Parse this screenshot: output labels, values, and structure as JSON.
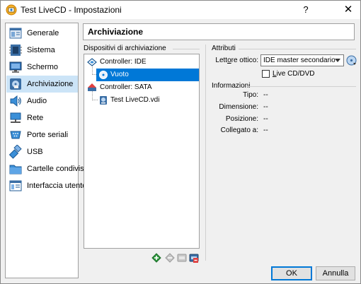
{
  "window": {
    "title": "Test LiveCD - Impostazioni",
    "help_label": "?",
    "close_label": "✕"
  },
  "nav": {
    "items": [
      {
        "label": "Generale",
        "icon": "general-icon"
      },
      {
        "label": "Sistema",
        "icon": "system-chip-icon"
      },
      {
        "label": "Schermo",
        "icon": "display-monitor-icon"
      },
      {
        "label": "Archiviazione",
        "icon": "storage-icon",
        "selected": true
      },
      {
        "label": "Audio",
        "icon": "speaker-icon"
      },
      {
        "label": "Rete",
        "icon": "network-icon"
      },
      {
        "label": "Porte seriali",
        "icon": "serial-port-icon"
      },
      {
        "label": "USB",
        "icon": "usb-icon"
      },
      {
        "label": "Cartelle condivise",
        "icon": "shared-folder-icon"
      },
      {
        "label": "Interfaccia utente",
        "icon": "user-interface-icon"
      }
    ]
  },
  "page": {
    "title": "Archiviazione"
  },
  "storage": {
    "group_title": "Dispositivi di archiviazione",
    "tree": [
      {
        "label": "Controller: IDE",
        "level": 0,
        "icon": "ide-controller-icon"
      },
      {
        "label": "Vuoto",
        "level": 1,
        "icon": "optical-disc-icon",
        "selected": true
      },
      {
        "label": "Controller: SATA",
        "level": 0,
        "icon": "sata-controller-icon"
      },
      {
        "label": "Test LiveCD.vdi",
        "level": 1,
        "icon": "hard-disk-icon"
      }
    ],
    "tools": [
      "add-attachment-icon",
      "remove-attachment-icon",
      "add-controller-icon",
      "remove-controller-icon"
    ]
  },
  "attributes": {
    "group_title": "Attributi",
    "optical_drive_label": "Lettore ottico:",
    "optical_drive_value": "IDE master secondario",
    "live_cd_label": "Live CD/DVD",
    "live_cd_checked": false
  },
  "info": {
    "group_title": "Informazioni",
    "rows": [
      {
        "label": "Tipo:",
        "value": "--"
      },
      {
        "label": "Dimensione:",
        "value": "--"
      },
      {
        "label": "Posizione:",
        "value": "--"
      },
      {
        "label": "Collegato a:",
        "value": "--"
      }
    ]
  },
  "buttons": {
    "ok": "OK",
    "cancel": "Annulla"
  },
  "colors": {
    "selection": "#0078d7",
    "nav_selection": "#cce4f7"
  }
}
